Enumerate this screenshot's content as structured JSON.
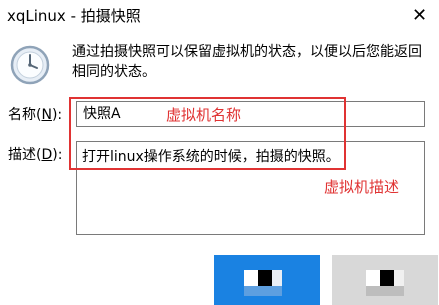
{
  "window": {
    "title": "xqLinux - 拍摄快照",
    "close_glyph": "✕"
  },
  "info": {
    "icon": "clock-icon",
    "text": "通过拍摄快照可以保留虚拟机的状态，以便以后您能返回相同的状态。"
  },
  "form": {
    "name_label_prefix": "名称(",
    "name_label_accel": "N",
    "name_label_suffix": "):",
    "name_value": "快照A",
    "desc_label_prefix": "描述(",
    "desc_label_accel": "D",
    "desc_label_suffix": "):",
    "desc_value": "打开linux操作系统的时候，拍摄的快照。"
  },
  "annotations": {
    "name_note": "虚拟机名称",
    "desc_note": "虚拟机描述",
    "color": "#e03333"
  },
  "buttons": {
    "ok_color": "#1a82e2",
    "cancel_color": "#d8d8d8"
  }
}
